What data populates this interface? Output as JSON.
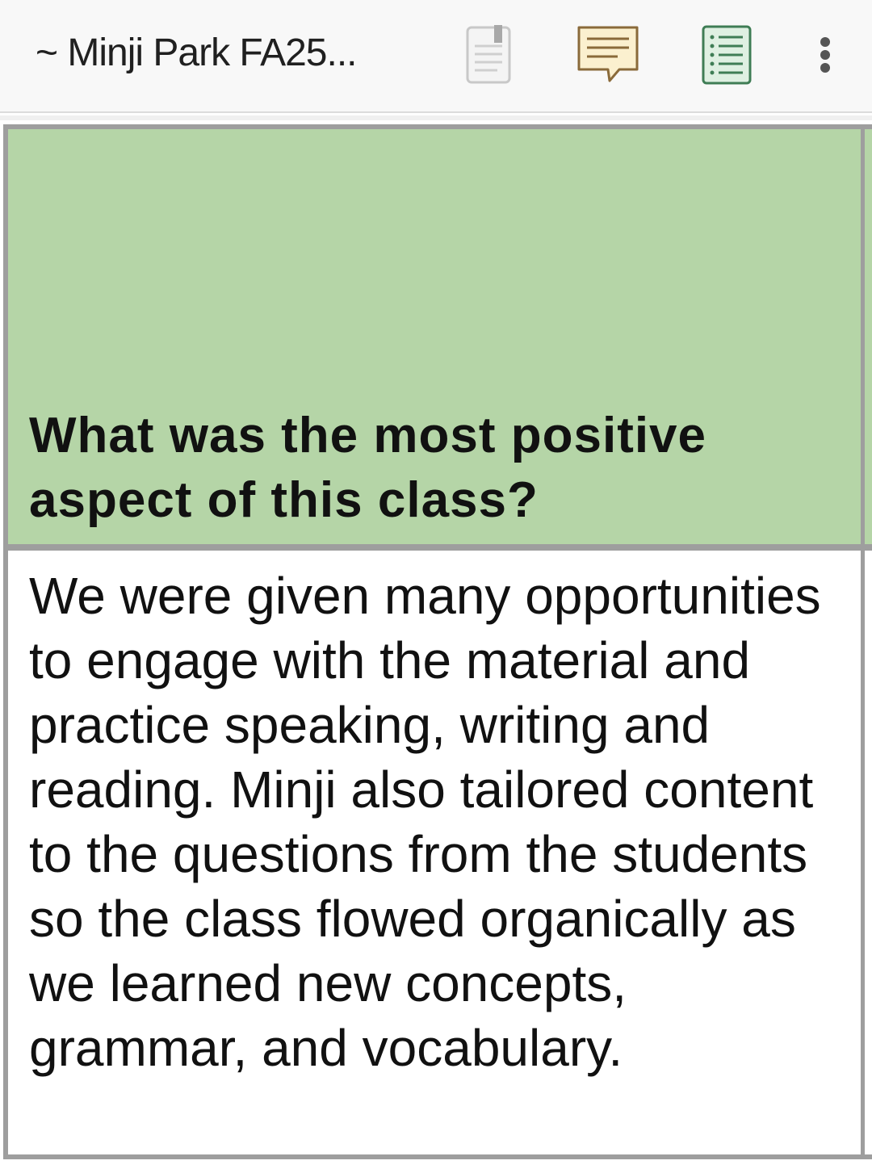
{
  "toolbar": {
    "title": "~ Minji Park FA25...",
    "icons": {
      "doc": "document-icon",
      "comment": "comment-icon",
      "list": "list-view-icon",
      "more": "more-options-icon"
    },
    "colors": {
      "comment_fill": "#fbf0cf",
      "comment_stroke": "#8a6a3a",
      "list_fill": "#dff0e2",
      "list_stroke": "#3f7d55"
    }
  },
  "sheet": {
    "header_cell_color": "#b5d5a7",
    "grid_color": "#9e9e9e",
    "question": "What was the most positive aspect of this class?",
    "answer": "We were given many opportunities to engage with the material and practice speaking, writing and reading. Minji also tailored content to the questions from the students so the class flowed organically as we learned new concepts, grammar, and vocabulary."
  }
}
